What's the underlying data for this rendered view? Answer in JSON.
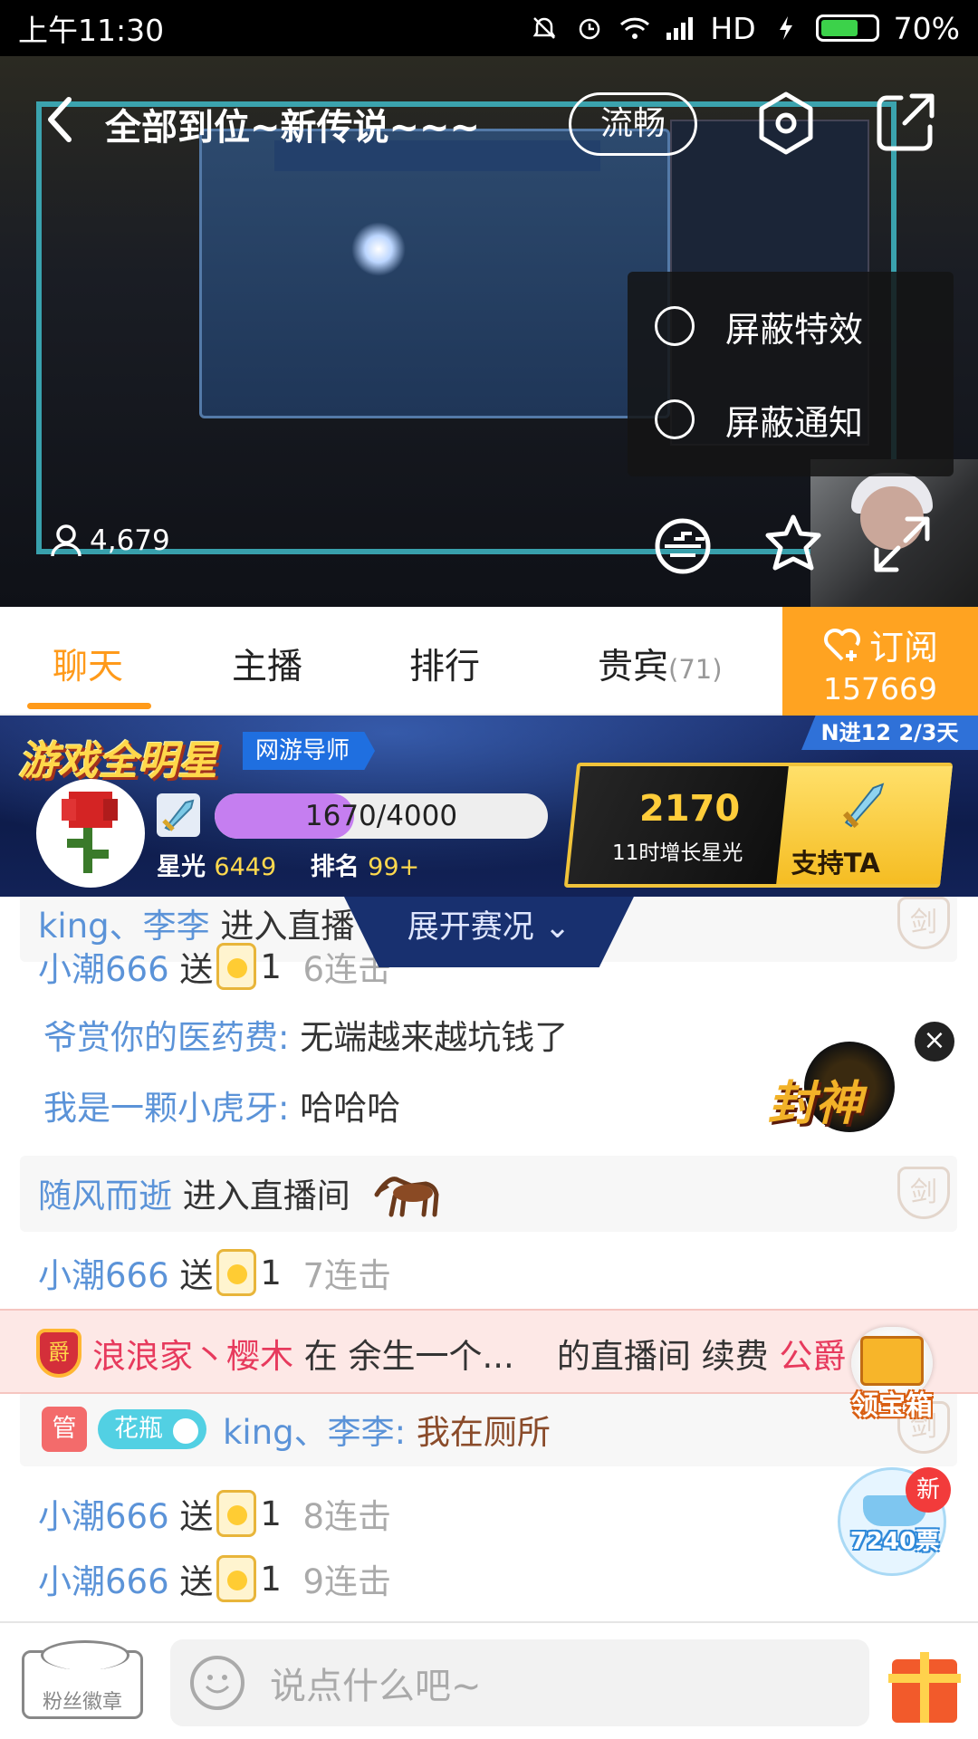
{
  "status_bar": {
    "time": "上午11:30",
    "network": "HD",
    "battery": "70%"
  },
  "video": {
    "title": "全部到位~新传说~~~",
    "quality_label": "流畅",
    "viewer_count": "4,679",
    "menu": [
      {
        "label": "屏蔽特效"
      },
      {
        "label": "屏蔽通知"
      }
    ]
  },
  "tabs": [
    {
      "label": "聊天",
      "active": true
    },
    {
      "label": "主播"
    },
    {
      "label": "排行"
    },
    {
      "label": "贵宾",
      "count": "(71)"
    }
  ],
  "subscribe": {
    "label": "订阅",
    "count": "157669"
  },
  "star_banner": {
    "logo": "游戏全明星",
    "tag": "网游导师",
    "rank_badge": "N进12 2/3天",
    "progress_text": "1670/4000",
    "progress_fraction": 0.4175,
    "starlight_label": "星光",
    "starlight_value": "6449",
    "rank_label": "排名",
    "rank_value": "99+",
    "growth_value": "2170",
    "growth_label": "11时增长星光",
    "support_label": "支持TA",
    "expand_label": "展开赛况 ⌄"
  },
  "chat": {
    "row0": {
      "nick": "king、李李",
      "text": "进入直播"
    },
    "row1": {
      "nick": "小潮666",
      "verb": "送",
      "qty": "1",
      "combo": "6连击"
    },
    "row2": {
      "nick": "爷赏你的医药费:",
      "text": "无端越来越坑钱了"
    },
    "row3": {
      "nick": "我是一颗小虎牙:",
      "text": "哈哈哈"
    },
    "row4": {
      "nick": "随风而逝",
      "text": "进入直播间"
    },
    "row5": {
      "nick": "小潮666",
      "verb": "送",
      "qty": "1",
      "combo": "7连击"
    },
    "renew": {
      "badge": "爵",
      "nick": "浪浪家丶樱木",
      "t1": "在",
      "host": "余生一个...",
      "t2": "的直播间 续费",
      "rank": "公爵"
    },
    "row7": {
      "mgr": "管",
      "vase": "花瓶",
      "nick": "king、李李:",
      "text": "我在厕所"
    },
    "row8": {
      "nick": "小潮666",
      "verb": "送",
      "qty": "1",
      "combo": "8连击"
    },
    "row9": {
      "nick": "小潮666",
      "verb": "送",
      "qty": "1",
      "combo": "9连击"
    },
    "shield_char": "剑"
  },
  "floating": {
    "ad_text": "封神",
    "chest_label": "领宝箱",
    "ship_label": "7240票",
    "new_badge": "新"
  },
  "bottom": {
    "fan_badge": "粉丝徽章",
    "placeholder": "说点什么吧~"
  },
  "colors": {
    "accent": "#ff9a1a",
    "nick_blue": "#5b93d8",
    "progress": "#c57ef0",
    "banner": "#1a2c69"
  }
}
